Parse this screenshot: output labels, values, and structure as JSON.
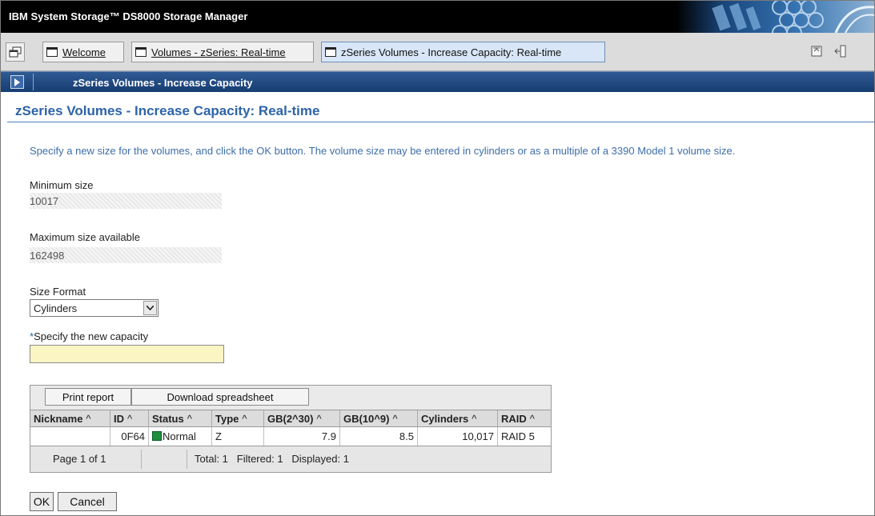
{
  "window": {
    "title": "IBM System Storage™ DS8000 Storage Manager"
  },
  "tabs": [
    {
      "label": "Welcome",
      "active": false
    },
    {
      "label": "Volumes - zSeries: Real-time",
      "active": false
    },
    {
      "label": "zSeries Volumes - Increase Capacity: Real-time",
      "active": true
    }
  ],
  "task": {
    "title": "zSeries Volumes - Increase Capacity"
  },
  "page": {
    "title": "zSeries Volumes - Increase Capacity: Real-time",
    "instructions": "Specify a new size for the volumes, and click the OK button. The volume size may be entered in cylinders or as a multiple of a 3390 Model 1 volume size."
  },
  "form": {
    "min_label": "Minimum size",
    "min_value": "10017",
    "max_label": "Maximum size available",
    "max_value": "162498",
    "format_label": "Size Format",
    "format_value": "Cylinders",
    "capacity_required_marker": "*",
    "capacity_label": "Specify the new capacity",
    "capacity_value": ""
  },
  "table": {
    "print_label": "Print report",
    "download_label": "Download spreadsheet",
    "sort_glyph": "^",
    "columns": [
      "Nickname",
      "ID",
      "Status",
      "Type",
      "GB(2^30)",
      "GB(10^9)",
      "Cylinders",
      "RAID"
    ],
    "rows": [
      {
        "nickname": "",
        "id": "0F64",
        "status": "Normal",
        "type": "Z",
        "gb_2_30": "7.9",
        "gb_10_9": "8.5",
        "cylinders": "10,017",
        "raid": "RAID 5"
      }
    ],
    "page_label": "Page 1 of 1",
    "totals": "Total: 1   Filtered: 1   Displayed: 1"
  },
  "actions": {
    "ok_label": "OK",
    "cancel_label": "Cancel"
  },
  "colors": {
    "accent": "#2d64a8",
    "header_bar": "#173d72",
    "required_field": "#fbf5c4",
    "status_normal": "#1f8f3e"
  },
  "icons": [
    "tabs-menu-icon",
    "tab-page-icon",
    "task-arrow-icon",
    "select-arrow-icon",
    "restore-icon",
    "logout-icon"
  ]
}
